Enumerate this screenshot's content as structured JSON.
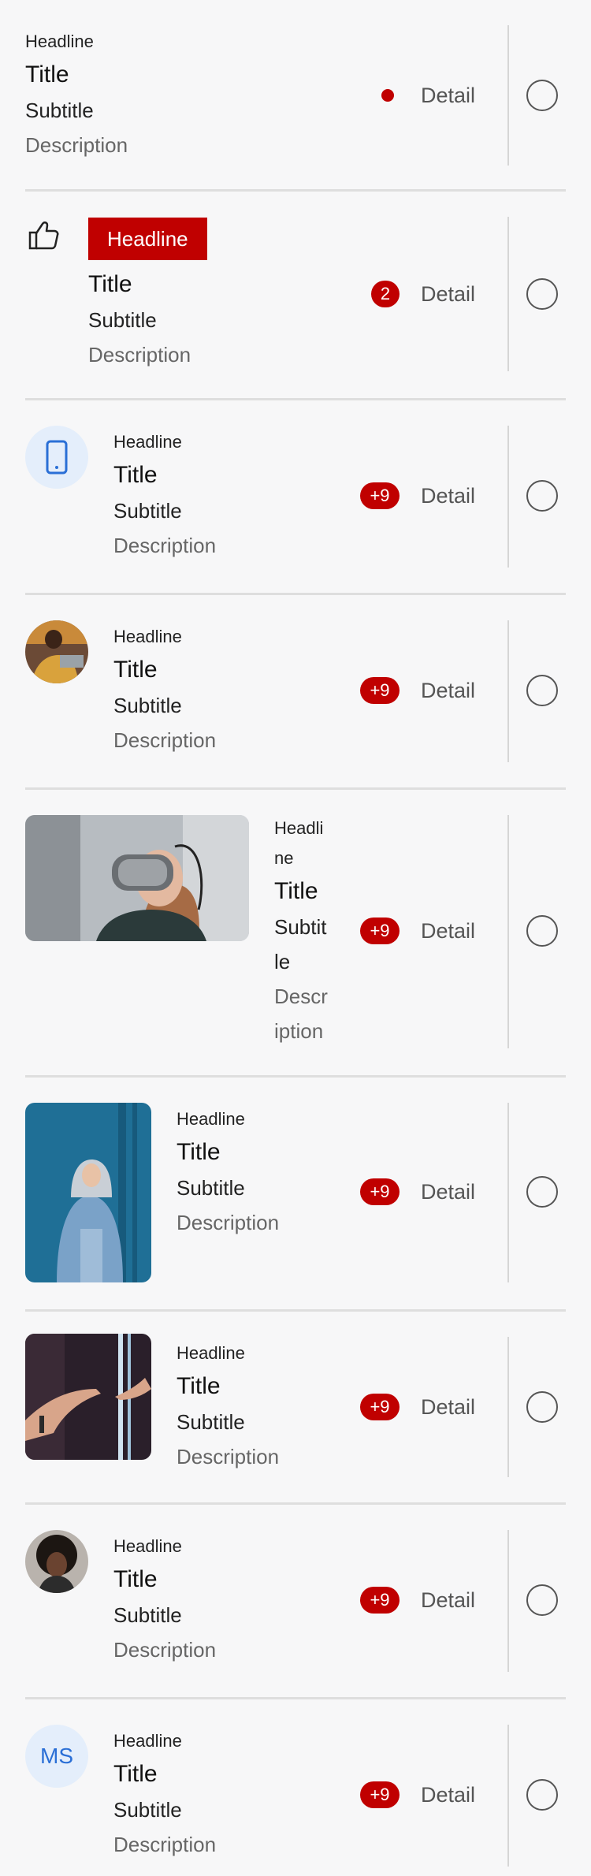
{
  "items": [
    {
      "headline": "Headline",
      "title": "Title",
      "subtitle": "Subtitle",
      "description": "Description",
      "detail": "Detail"
    },
    {
      "headline": "Headline",
      "title": "Title",
      "subtitle": "Subtitle",
      "description": "Description",
      "detail": "Detail",
      "badge": "2",
      "leading_icon": "thumbs-up-icon"
    },
    {
      "headline": "Headline",
      "title": "Title",
      "subtitle": "Subtitle",
      "description": "Description",
      "detail": "Detail",
      "badge": "+9",
      "leading_icon": "smartphone-icon"
    },
    {
      "headline": "Headline",
      "title": "Title",
      "subtitle": "Subtitle",
      "description": "Description",
      "detail": "Detail",
      "badge": "+9"
    },
    {
      "headline_lines": [
        "Headli",
        "ne"
      ],
      "title": "Title",
      "subtitle_lines": [
        "Subtit",
        "le"
      ],
      "description_lines": [
        "Descr",
        "iption"
      ],
      "detail": "Detail",
      "badge": "+9"
    },
    {
      "headline": "Headline",
      "title": "Title",
      "subtitle": "Subtitle",
      "description": "Description",
      "detail": "Detail",
      "badge": "+9"
    },
    {
      "headline": "Headline",
      "title": "Title",
      "subtitle": "Subtitle",
      "description": "Description",
      "detail": "Detail",
      "badge": "+9"
    },
    {
      "headline": "Headline",
      "title": "Title",
      "subtitle": "Subtitle",
      "description": "Description",
      "detail": "Detail",
      "badge": "+9"
    },
    {
      "headline": "Headline",
      "title": "Title",
      "subtitle": "Subtitle",
      "description": "Description",
      "detail": "Detail",
      "badge": "+9",
      "initials": "MS"
    }
  ],
  "colors": {
    "accent": "#c00000",
    "icon_bg": "#e4eefb",
    "icon_fg": "#2a6fd6",
    "divider": "#dedede"
  }
}
